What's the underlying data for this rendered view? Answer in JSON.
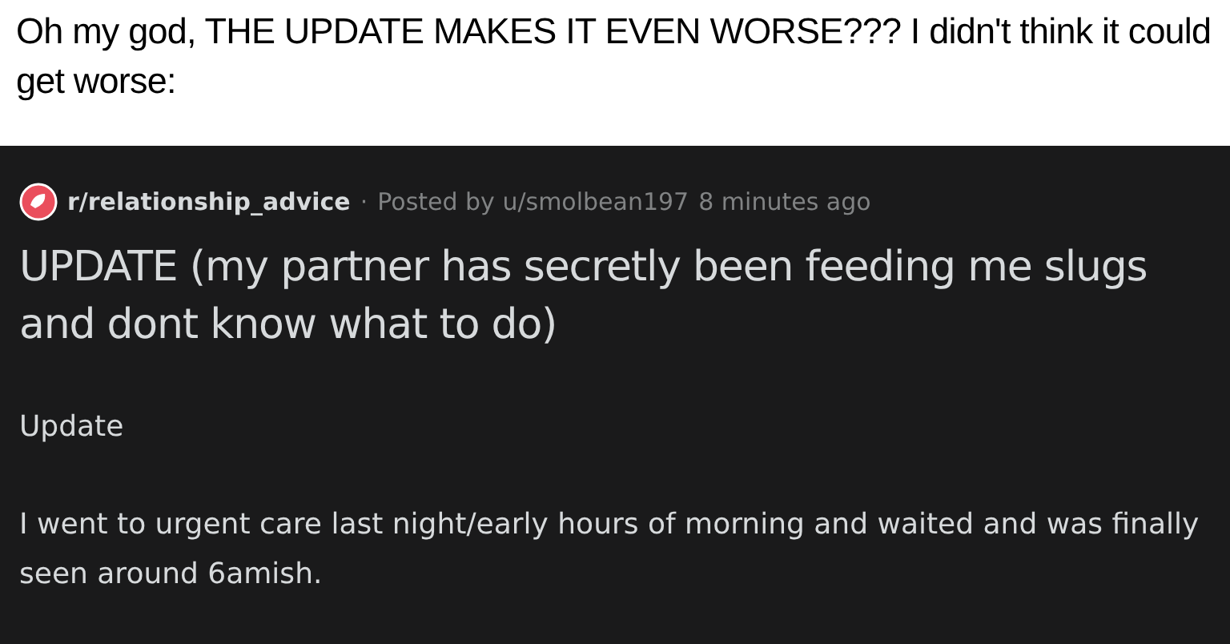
{
  "caption": "Oh my god, THE UPDATE MAKES IT EVEN WORSE??? I didn't think it could get worse:",
  "post": {
    "subreddit": "r/relationship_advice",
    "separator": "·",
    "posted_by": "Posted by u/smolbean197",
    "time": "8 minutes ago",
    "title": "UPDATE (my partner has secretly been feeding me slugs and dont know what to do)",
    "paragraphs": [
      "Update",
      "I went to urgent care last night/early hours of morning and waited and was finally seen around 6amish."
    ]
  }
}
